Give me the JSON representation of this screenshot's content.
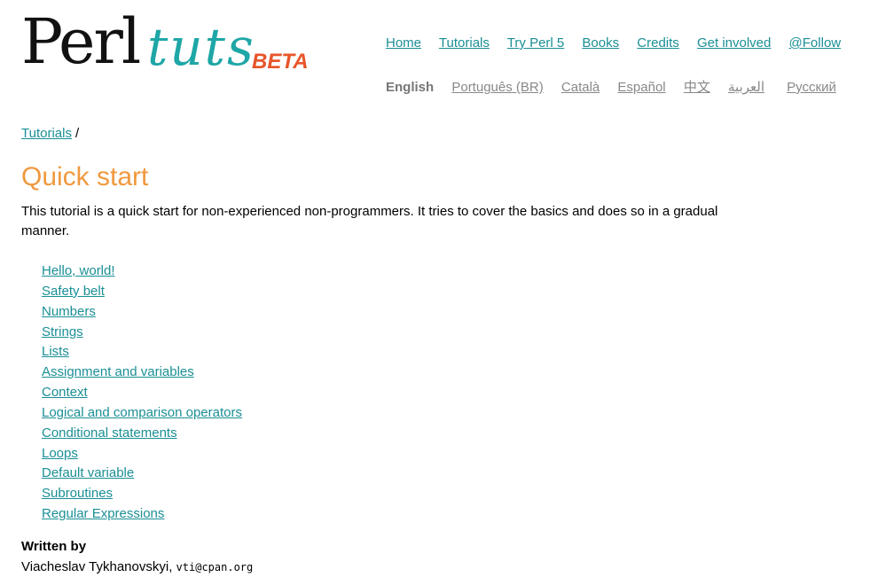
{
  "logo": {
    "perl": "Perl",
    "tuts": "tuts",
    "beta": "BETA"
  },
  "nav": {
    "items": [
      "Home",
      "Tutorials",
      "Try Perl 5",
      "Books",
      "Credits",
      "Get involved",
      "@Follow"
    ]
  },
  "languages": {
    "current": "English",
    "items": [
      "Português (BR)",
      "Català",
      "Español",
      "中文",
      "العربية",
      "Русский"
    ]
  },
  "breadcrumb": {
    "link": "Tutorials",
    "separator": "/"
  },
  "page": {
    "title": "Quick start",
    "intro": "This tutorial is a quick start for non-experienced non-programmers. It tries to cover the basics and does so in a gradual manner."
  },
  "toc": [
    "Hello, world!",
    "Safety belt",
    "Numbers",
    "Strings",
    "Lists",
    "Assignment and variables",
    "Context",
    "Logical and comparison operators",
    "Conditional statements",
    "Loops",
    "Default variable",
    "Subroutines",
    "Regular Expressions"
  ],
  "author": {
    "heading": "Written by",
    "name": "Viacheslav Tykhanovskyi,",
    "email": "vti@cpan.org"
  },
  "colors": {
    "link": "#1a8f95",
    "title": "#f0993f",
    "logo_tuts": "#1fa6a6",
    "logo_beta": "#e8552a",
    "lang_link": "#888888"
  }
}
